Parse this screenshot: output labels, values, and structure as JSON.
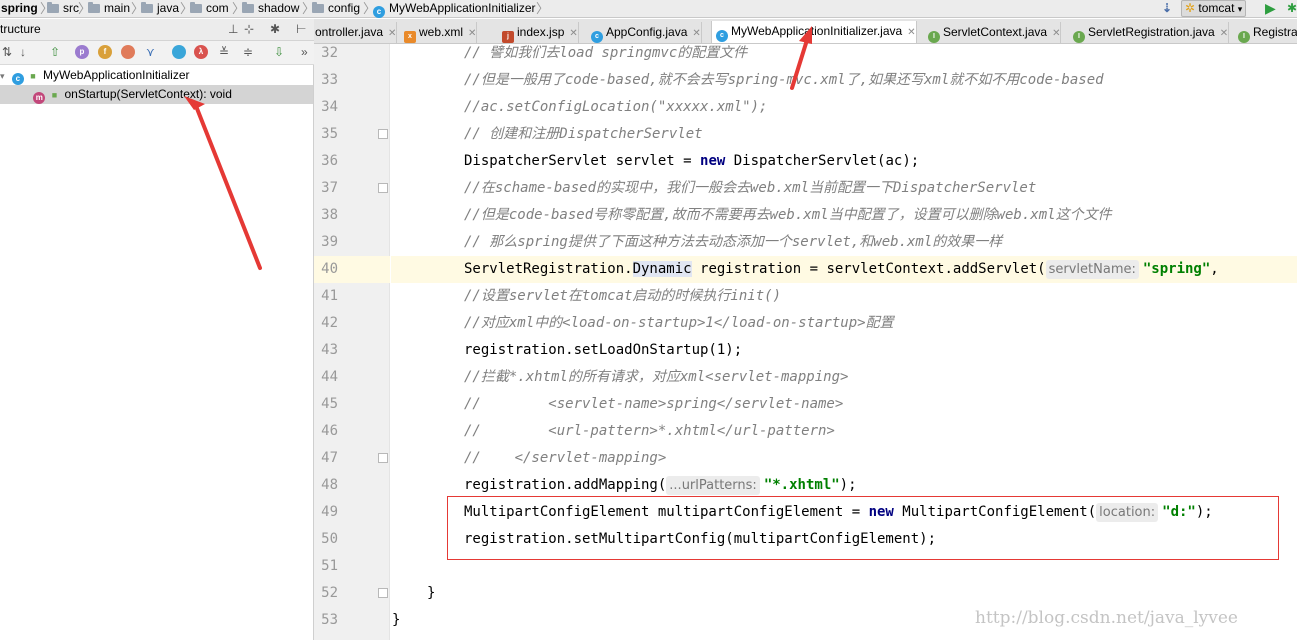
{
  "breadcrumb": {
    "project": "spring",
    "folders": [
      "src",
      "main",
      "java",
      "com",
      "shadow",
      "config"
    ],
    "file": "MyWebApplicationInitializer"
  },
  "run_config": {
    "name": "tomcat"
  },
  "structure_panel": {
    "title": "tructure",
    "class_name": "MyWebApplicationInitializer",
    "method": "onStartup(ServletContext): void",
    "toolbar_marks": [
      "p",
      "f",
      "λ"
    ]
  },
  "tabs": [
    {
      "label": "ontroller.java",
      "icon": "class-icon",
      "active": false
    },
    {
      "label": "web.xml",
      "icon": "xml-file-icon",
      "active": false
    },
    {
      "label": "index.jsp",
      "icon": "jsp-file-icon",
      "active": false
    },
    {
      "label": "AppConfig.java",
      "icon": "class-icon",
      "active": false
    },
    {
      "label": "MyWebApplicationInitializer.java",
      "icon": "class-icon",
      "active": true
    },
    {
      "label": "ServletContext.java",
      "icon": "interface-icon",
      "active": false
    },
    {
      "label": "ServletRegistration.java",
      "icon": "interface-icon",
      "active": false
    },
    {
      "label": "Registra",
      "icon": "interface-icon",
      "active": false
    }
  ],
  "editor": {
    "current_line": 40,
    "lines": [
      {
        "no": "32",
        "text": "// 譬如我们去load springmvc的配置文件"
      },
      {
        "no": "33",
        "text": "//但是一般用了code-based,就不会去写spring-mvc.xml了,如果还写xml就不如不用code-based"
      },
      {
        "no": "34",
        "text": "//ac.setConfigLocation(\"xxxxx.xml\");"
      },
      {
        "no": "35",
        "text": "// 创建和注册DispatcherServlet"
      },
      {
        "no": "36",
        "a": "DispatcherServlet servlet = ",
        "kw": "new",
        "b": " DispatcherServlet(ac);"
      },
      {
        "no": "37",
        "text": "//在schame-based的实现中，我们一般会去web.xml当前配置一下DispatcherServlet"
      },
      {
        "no": "38",
        "text": "//但是code-based号称零配置,故而不需要再去web.xml当中配置了，设置可以删除web.xml这个文件"
      },
      {
        "no": "39",
        "text": "// 那么spring提供了下面这种方法去动态添加一个servlet,和web.xml的效果一样"
      },
      {
        "no": "40",
        "a": "ServletRegistration.",
        "hl": "Dynamic",
        "b": " registration = servletContext.addServlet(",
        "hint": "servletName:",
        "str": "\"spring\"",
        "c": ","
      },
      {
        "no": "41",
        "text": "//设置servlet在tomcat启动的时候执行init()"
      },
      {
        "no": "42",
        "text": "//对应xml中的<load-on-startup>1</load-on-startup>配置"
      },
      {
        "no": "43",
        "a": "registration.setLoadOnStartup(1);"
      },
      {
        "no": "44",
        "text": "//拦截*.xhtml的所有请求，对应xml<servlet-mapping>"
      },
      {
        "no": "45",
        "text": "//        <servlet-name>spring</servlet-name>"
      },
      {
        "no": "46",
        "text": "//        <url-pattern>*.xhtml</url-pattern>"
      },
      {
        "no": "47",
        "text": "//    </servlet-mapping>"
      },
      {
        "no": "48",
        "a": "registration.addMapping(",
        "hint": "...urlPatterns:",
        "str": "\"*.xhtml\"",
        "c": ");"
      },
      {
        "no": "49",
        "a": "MultipartConfigElement multipartConfigElement = ",
        "kw": "new",
        "b": " MultipartConfigElement(",
        "hint": "location:",
        "str": "\"d:\"",
        "c": ");"
      },
      {
        "no": "50",
        "a": "registration.setMultipartConfig(multipartConfigElement);"
      },
      {
        "no": "51",
        "a": ""
      },
      {
        "no": "52",
        "a": "}"
      },
      {
        "no": "53",
        "a": "}"
      }
    ]
  },
  "watermark": "http://blog.csdn.net/java_lyvee",
  "colors": {
    "annotation": "#e53935",
    "current_line": "#fffae3",
    "comment": "#808080",
    "keyword": "#000080",
    "string": "#008000"
  }
}
